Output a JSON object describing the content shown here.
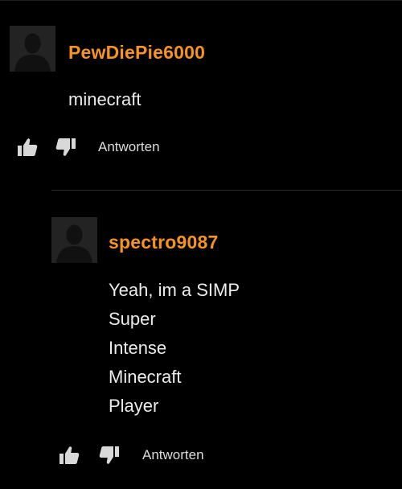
{
  "comments": [
    {
      "username": "PewDiePie6000",
      "lines": [
        "minecraft"
      ],
      "reply_label": "Antworten"
    },
    {
      "username": "spectro9087",
      "lines": [
        "Yeah, im a SIMP",
        "Super",
        "Intense",
        "Minecraft",
        "Player"
      ],
      "reply_label": "Antworten"
    }
  ],
  "icons": {
    "avatar": "default-user-avatar-icon",
    "like": "thumbs-up-icon",
    "dislike": "thumbs-down-icon"
  },
  "colors": {
    "background": "#000000",
    "username": "#f7931e",
    "text": "#ececec",
    "avatar_bg": "#232323"
  }
}
